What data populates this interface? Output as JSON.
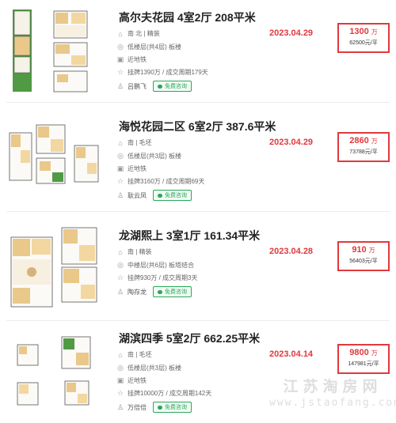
{
  "labels": {
    "consult": "免费咨询"
  },
  "colors": {
    "accent_red": "#e0393e",
    "consult_green": "#2aa85a"
  },
  "icons": {
    "orientation": "compass-icon",
    "floor": "building-icon",
    "subway": "subway-icon",
    "listing": "tag-icon",
    "agent": "person-icon"
  },
  "listings": [
    {
      "title": "高尔夫花园 4室2厅 208平米",
      "orientation": "南 北 | 精装",
      "floor": "低楼层(共4层) 板楼",
      "subway": "近地铁",
      "listing": "挂牌1390万 / 成交周期179天",
      "agent": "吕鹏飞",
      "date": "2023.04.29",
      "price": "1300",
      "price_unit": "万",
      "unit_price": "62500元/平"
    },
    {
      "title": "海悦花园二区 6室2厅 387.6平米",
      "orientation": "南 | 毛坯",
      "floor": "低楼层(共3层) 板楼",
      "subway": "近地铁",
      "listing": "挂牌3160万 / 成交周期69天",
      "agent": "耿云凤",
      "date": "2023.04.29",
      "price": "2860",
      "price_unit": "万",
      "unit_price": "73788元/平"
    },
    {
      "title": "龙湖熙上 3室1厅 161.34平米",
      "orientation": "南 | 精装",
      "floor": "中楼层(共6层) 板塔结合",
      "subway": "",
      "listing": "挂牌930万 / 成交周期3天",
      "agent": "陶存龙",
      "date": "2023.04.28",
      "price": "910",
      "price_unit": "万",
      "unit_price": "56403元/平"
    },
    {
      "title": "湖滨四季 5室2厅 662.25平米",
      "orientation": "南 | 毛坯",
      "floor": "低楼层(共3层) 板楼",
      "subway": "近地铁",
      "listing": "挂牌10000万 / 成交周期142天",
      "agent": "万倍倍",
      "date": "2023.04.14",
      "price": "9800",
      "price_unit": "万",
      "unit_price": "147981元/平"
    }
  ],
  "watermark": {
    "text": "江苏淘房网",
    "url": "www.jstaofang.com"
  }
}
